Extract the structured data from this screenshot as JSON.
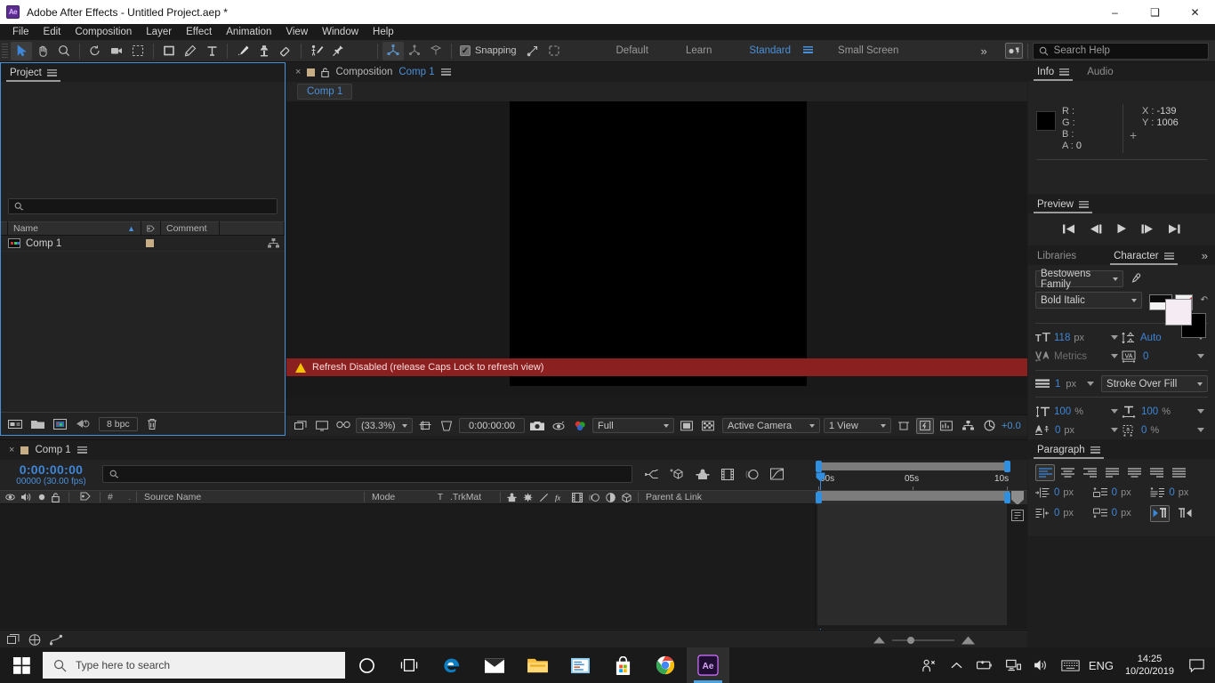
{
  "window": {
    "app_icon": "ae-logo-icon",
    "title": "Adobe After Effects - Untitled Project.aep *",
    "minimize": "–",
    "maximize": "❑",
    "close": "✕"
  },
  "menubar": {
    "items": [
      "File",
      "Edit",
      "Composition",
      "Layer",
      "Effect",
      "Animation",
      "View",
      "Window",
      "Help"
    ]
  },
  "toolbar": {
    "snapping_label": "Snapping",
    "snapping_checked": "✓",
    "workspaces": [
      {
        "label": "Default",
        "active": false
      },
      {
        "label": "Learn",
        "active": false
      },
      {
        "label": "Standard",
        "active": true
      },
      {
        "label": "Small Screen",
        "active": false
      }
    ],
    "overflow": "»",
    "search_placeholder": "Search Help",
    "search_icon": "magnifier-icon"
  },
  "project": {
    "tab_label": "Project",
    "search_value": "",
    "columns": [
      "Name",
      "Comment"
    ],
    "sort_arrow": "▲",
    "rows": [
      {
        "name": "Comp 1",
        "label_color": "#c7ad85"
      }
    ],
    "footer": {
      "bit_depth": "8 bpc"
    }
  },
  "composition": {
    "close_tab": "×",
    "title_prefix": "Composition",
    "title_name": "Comp 1",
    "chip_label": "Comp 1",
    "warning": "Refresh Disabled (release Caps Lock to refresh view)",
    "footer": {
      "zoom": "(33.3%)",
      "timecode": "0:00:00:00",
      "resolution": "Full",
      "camera": "Active Camera",
      "views": "1 View",
      "exposure": "+0.0"
    }
  },
  "info": {
    "tabs": [
      {
        "label": "Info",
        "active": true
      },
      {
        "label": "Audio",
        "active": false
      }
    ],
    "r_label": "R :",
    "g_label": "G :",
    "b_label": "B :",
    "a_label": "A :",
    "r_value": "",
    "g_value": "",
    "b_value": "",
    "a_value": "0",
    "x_label": "X :",
    "y_label": "Y :",
    "x_value": "-139",
    "y_value": "1006",
    "color_swatch": "#000000"
  },
  "preview": {
    "tab_label": "Preview",
    "buttons": [
      "first-frame",
      "previous-frame",
      "play",
      "next-frame",
      "last-frame"
    ]
  },
  "character": {
    "tabs": [
      {
        "label": "Libraries",
        "active": false
      },
      {
        "label": "Character",
        "active": true
      }
    ],
    "overflow": "»",
    "font_family": "Bestowens Family",
    "font_style": "Bold Italic",
    "font_size": "118",
    "font_size_unit": "px",
    "leading": "Auto",
    "kerning": "Metrics",
    "tracking": "0",
    "stroke_width": "1",
    "stroke_width_unit": "px",
    "stroke_mode": "Stroke Over Fill",
    "vertical_scale": "100",
    "vertical_scale_unit": "%",
    "horizontal_scale": "100",
    "horizontal_scale_unit": "%",
    "baseline_shift": "0",
    "baseline_shift_unit": "px",
    "tsume": "0",
    "tsume_unit": "%",
    "fill_color": "#f4ecf2",
    "stroke_color": "#000000"
  },
  "paragraph": {
    "tab_label": "Paragraph",
    "align_buttons": [
      "align-left",
      "align-center",
      "align-right",
      "justify-last-left",
      "justify-last-center",
      "justify-last-right",
      "justify-all"
    ],
    "indent_left": "0",
    "indent_left_unit": "px",
    "indent_right": "0",
    "indent_right_unit": "px",
    "indent_first": "0",
    "indent_first_unit": "px",
    "space_before": "0",
    "space_before_unit": "px",
    "space_after": "0",
    "space_after_unit": "px"
  },
  "timeline": {
    "close_tab": "×",
    "tab_label": "Comp 1",
    "timecode": "0:00:00:00",
    "frames": "00000 (30.00 fps)",
    "search_value": "",
    "columns": [
      "Source Name",
      "Mode",
      "T",
      ".TrkMat",
      "Parent & Link"
    ],
    "col_hash": "#",
    "ruler_ticks": [
      {
        "label": "00s",
        "pos": 0
      },
      {
        "label": "05s",
        "pos": 50
      },
      {
        "label": "10s",
        "pos": 100
      }
    ]
  },
  "taskbar": {
    "search_placeholder": "Type here to search",
    "search_icon": "magnifier-icon",
    "start_icon": "windows-start-icon",
    "pinned": [
      "cortana-icon",
      "task-view-icon",
      "edge-icon",
      "mail-icon",
      "file-explorer-icon",
      "powerpoint-icon",
      "store-icon",
      "chrome-icon",
      "after-effects-icon"
    ],
    "tray": [
      "people-icon",
      "show-hidden-icon",
      "battery-icon",
      "network-icon",
      "volume-icon",
      "keyboard-icon"
    ],
    "language": "ENG",
    "time": "14:25",
    "date": "10/20/2019",
    "action_center": "action-center-icon"
  }
}
